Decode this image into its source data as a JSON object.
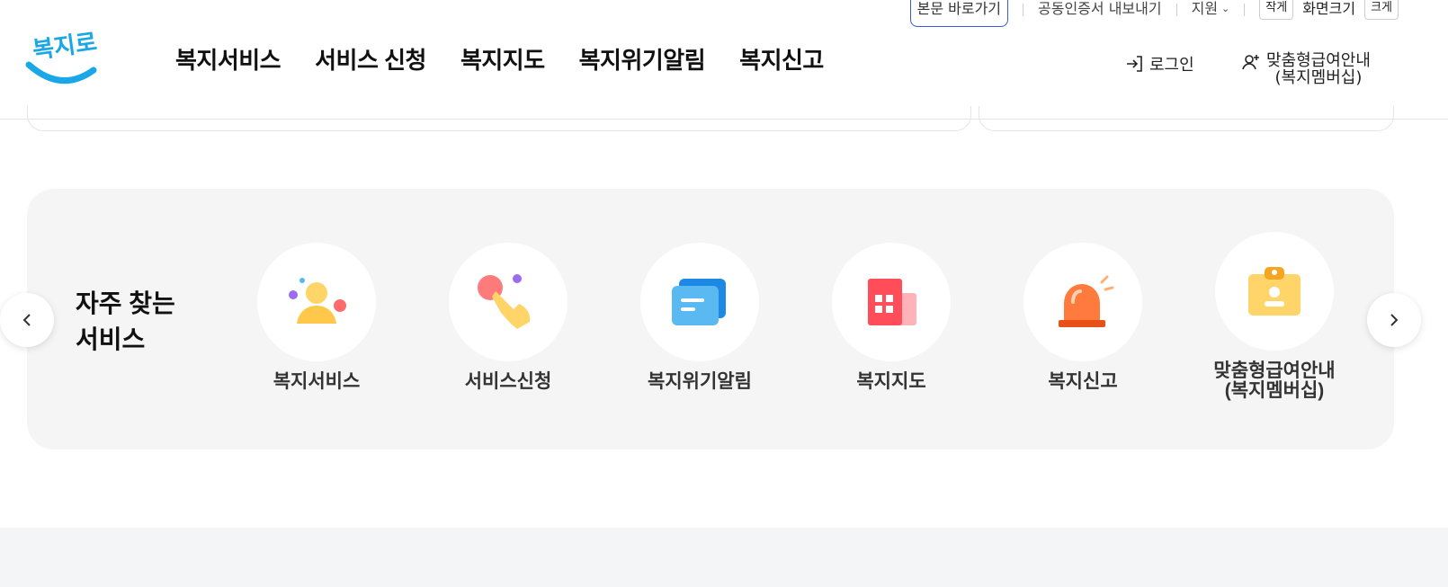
{
  "utility": {
    "skip_link": "본문 바로가기",
    "cert_export": "공동인증서 내보내기",
    "support": "지원",
    "size_small": "작게",
    "size_label": "화면크기",
    "size_large": "크게"
  },
  "header": {
    "logo_text": "복지로",
    "nav": [
      "복지서비스",
      "서비스 신청",
      "복지지도",
      "복지위기알림",
      "복지신고"
    ],
    "login": "로그인",
    "member_line1": "맞춤형급여안내",
    "member_line2": "(복지멤버십)"
  },
  "frequent": {
    "title_line1": "자주 찾는",
    "title_line2": "서비스",
    "items": [
      {
        "label": "복지서비스",
        "icon": "person-icon"
      },
      {
        "label": "서비스신청",
        "icon": "hand-tap-icon"
      },
      {
        "label": "복지위기알림",
        "icon": "message-icon"
      },
      {
        "label": "복지지도",
        "icon": "building-icon"
      },
      {
        "label": "복지신고",
        "icon": "siren-icon"
      },
      {
        "label_line1": "맞춤형급여안내",
        "label_line2": "(복지멤버십)",
        "icon": "id-clipboard-icon"
      }
    ]
  },
  "colors": {
    "accent_blue": "#3b5bdb",
    "logo_blue": "#1aa7e8",
    "panel_bg": "#f5f5f6"
  }
}
